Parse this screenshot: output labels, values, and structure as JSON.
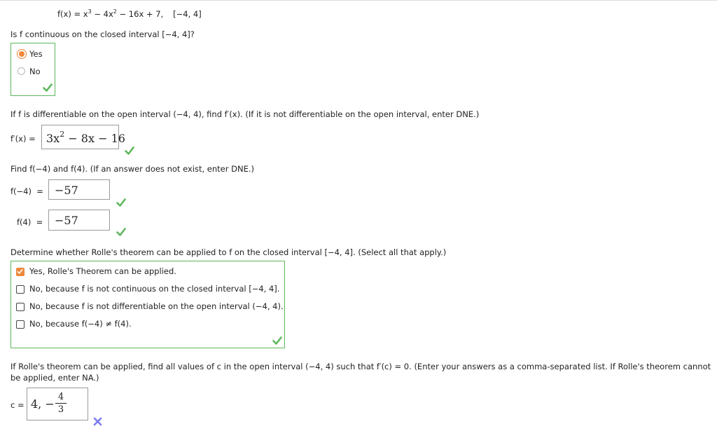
{
  "header": {
    "function_text": "f(x) = x",
    "exp1": "3",
    "mid_text": " − 4x",
    "exp2": "2",
    "tail_text": " − 16x + 7,",
    "interval": "[−4, 4]"
  },
  "q1": {
    "prompt": "Is f continuous on the closed interval [−4, 4]?",
    "options": [
      "Yes",
      "No"
    ],
    "selected": "Yes"
  },
  "q2": {
    "prompt": "If f is differentiable on the open interval (−4, 4), find f′(x). (If it is not differentiable on the open interval, enter DNE.)",
    "label": "f′(x) =",
    "answer_base": "3x",
    "answer_exp": "2",
    "answer_rest": " − 8x − 16"
  },
  "q3": {
    "prompt": "Find f(−4) and f(4). (If an answer does not exist, enter DNE.)",
    "label_a": "f(−4)  =",
    "answer_a": "−57",
    "label_b": "f(4)  =",
    "answer_b": "−57"
  },
  "q4": {
    "prompt": "Determine whether Rolle's theorem can be applied to f on the closed interval [−4, 4]. (Select all that apply.)",
    "options": [
      "Yes, Rolle's Theorem can be applied.",
      "No, because f is not continuous on the closed interval [−4, 4].",
      "No, because f is not differentiable on the open interval (−4, 4).",
      "No, because f(−4) ≠ f(4)."
    ],
    "checked": [
      true,
      false,
      false,
      false
    ]
  },
  "q5": {
    "prompt_line1": "If Rolle's theorem can be applied, find all values of c in the open interval (−4, 4) such that f′(c) = 0. (Enter your answers as a comma-separated list. If Rolle's theorem cannot",
    "prompt_line2": "be applied, enter NA.)",
    "label": "c =",
    "answer_lead": "4, −",
    "frac_num": "4",
    "frac_den": "3"
  },
  "colors": {
    "correct": "#5cb85c",
    "incorrect": "#7b7bf0",
    "accent": "#f0883a"
  }
}
